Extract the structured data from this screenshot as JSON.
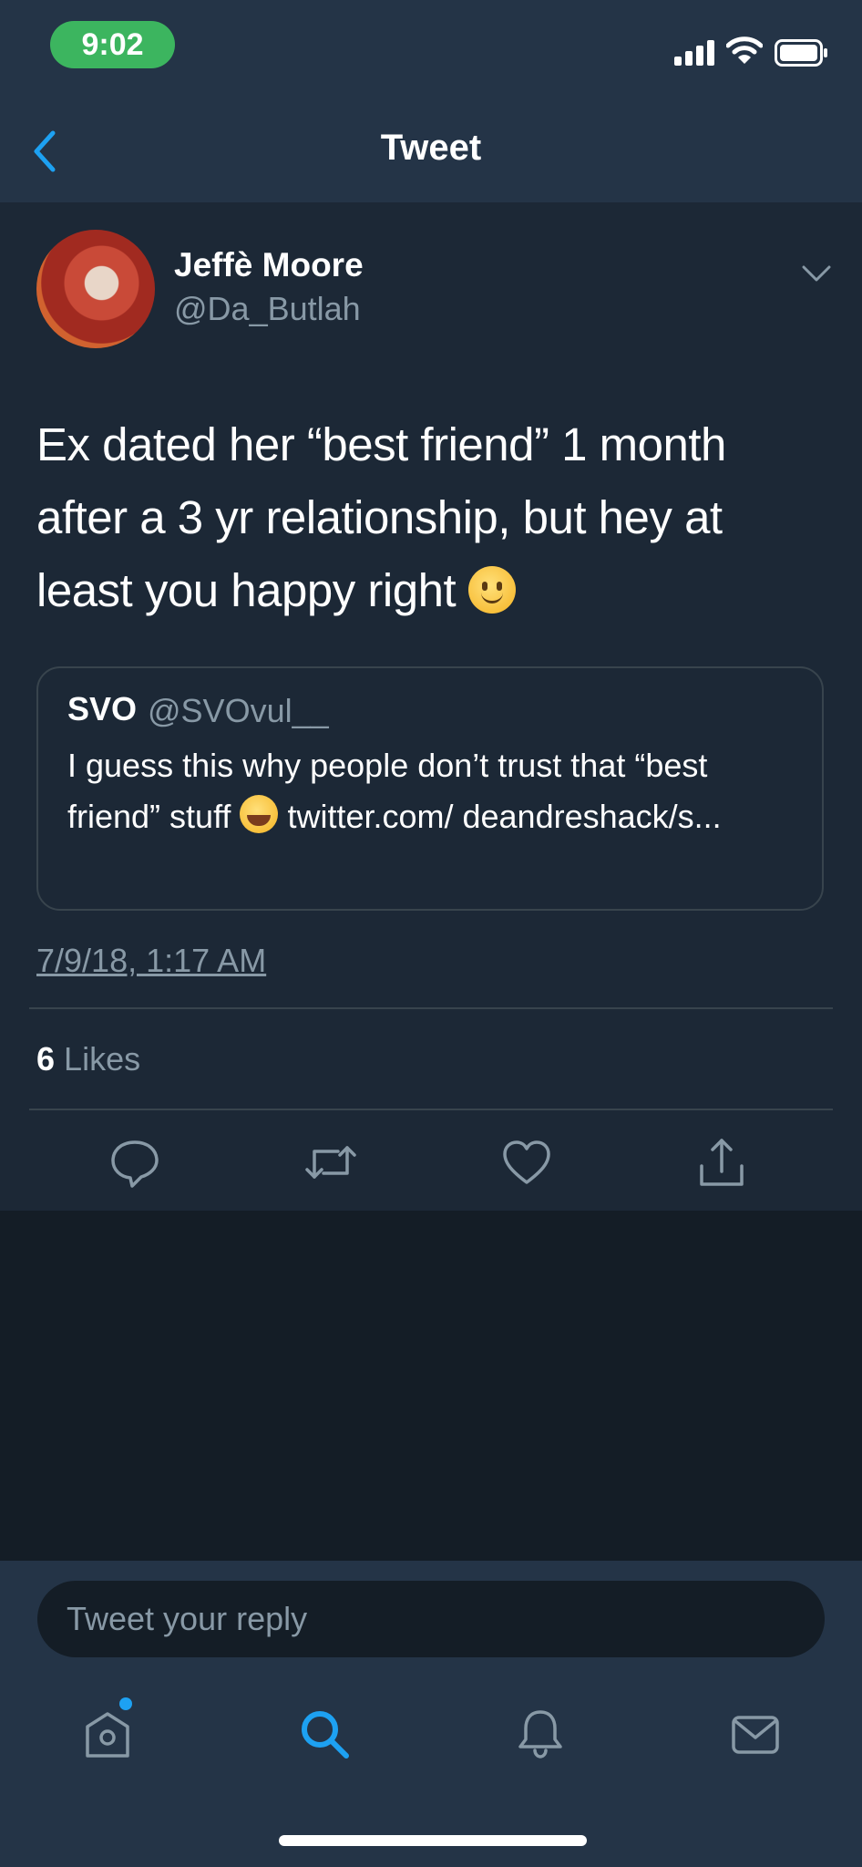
{
  "status_bar": {
    "time": "9:02"
  },
  "nav": {
    "title": "Tweet"
  },
  "tweet": {
    "author_name": "Jeffè Moore",
    "author_handle": "@Da_Butlah",
    "text": "Ex dated her “best friend” 1 month after a 3 yr relationship, but hey at least you happy right",
    "quoted": {
      "name": "SVO",
      "handle": "@SVOvul__",
      "text_before_emoji": "I guess this why people don’t trust that “best friend” stuff",
      "text_after_emoji": "twitter.com/ deandreshack/s..."
    },
    "timestamp": "7/9/18, 1:17 AM",
    "likes_count": "6",
    "likes_label": "Likes"
  },
  "reply": {
    "placeholder": "Tweet your reply"
  },
  "icons": {
    "back": "chevron-left-icon",
    "caret": "chevron-down-icon",
    "actions": [
      "reply-icon",
      "retweet-icon",
      "like-icon",
      "share-icon"
    ],
    "tabs": [
      "home-icon",
      "search-icon",
      "notifications-icon",
      "messages-icon"
    ]
  },
  "colors": {
    "accent": "#1da1f2",
    "status_pill": "#3cb55f",
    "background": "#141d26",
    "card": "#1c2836",
    "bar": "#243447",
    "secondary_text": "#8899a6"
  }
}
